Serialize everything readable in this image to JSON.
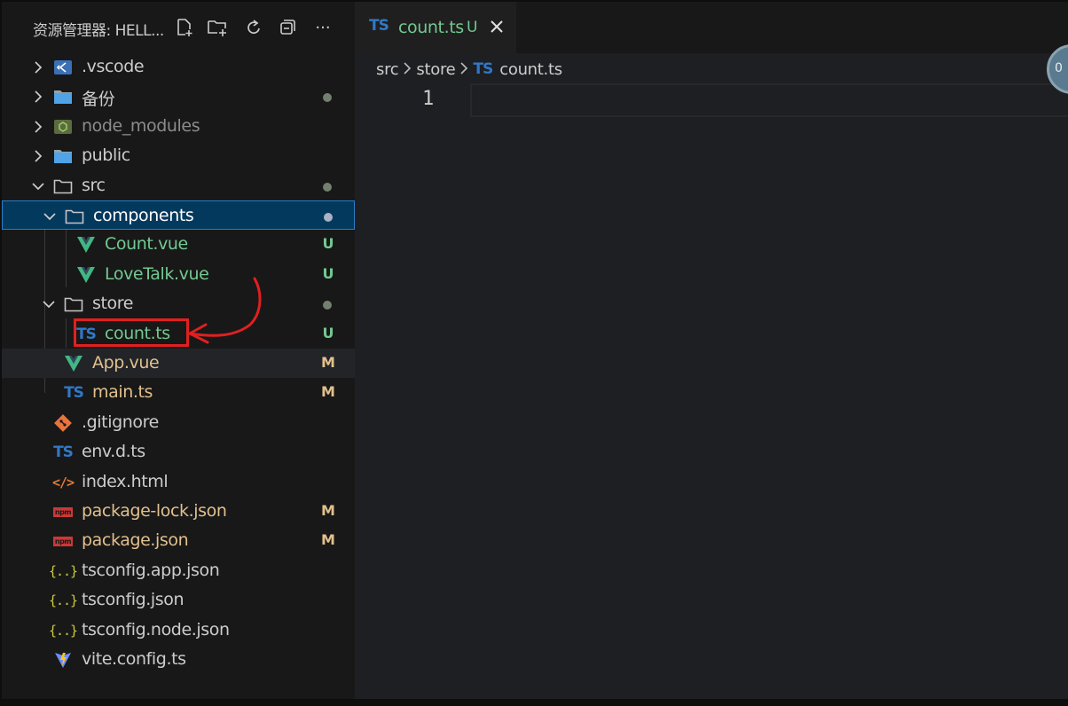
{
  "explorer": {
    "title": "资源管理器: HELL...",
    "actions": [
      "new-file-icon",
      "new-folder-icon",
      "refresh-icon",
      "collapse-all-icon",
      "more-icon"
    ],
    "more_label": "···"
  },
  "tree": [
    {
      "name": ".vscode",
      "type": "folder-vscode",
      "expanded": false,
      "depth": 0,
      "color": "#cccccc"
    },
    {
      "name": "备份",
      "type": "folder",
      "expanded": false,
      "depth": 0,
      "color": "#cccccc",
      "status": "dot"
    },
    {
      "name": "node_modules",
      "type": "folder-node",
      "expanded": false,
      "depth": 0,
      "color": "#8c8c8c"
    },
    {
      "name": "public",
      "type": "folder",
      "expanded": false,
      "depth": 0,
      "color": "#cccccc"
    },
    {
      "name": "src",
      "type": "folder-open",
      "expanded": true,
      "depth": 0,
      "color": "#cccccc",
      "status": "dot"
    },
    {
      "name": "components",
      "type": "folder-open",
      "expanded": true,
      "depth": 1,
      "color": "#ffffff",
      "status": "dot",
      "selected": true
    },
    {
      "name": "Count.vue",
      "type": "vue",
      "depth": 2,
      "color": "#73c991",
      "status": "U"
    },
    {
      "name": "LoveTalk.vue",
      "type": "vue",
      "depth": 2,
      "color": "#73c991",
      "status": "U"
    },
    {
      "name": "store",
      "type": "folder-open",
      "expanded": true,
      "depth": 1,
      "color": "#cccccc",
      "status": "dot"
    },
    {
      "name": "count.ts",
      "type": "ts",
      "depth": 2,
      "color": "#73c991",
      "status": "U"
    },
    {
      "name": "App.vue",
      "type": "vue",
      "depth": 1,
      "color": "#e2c08d",
      "status": "M",
      "hovered": true
    },
    {
      "name": "main.ts",
      "type": "ts",
      "depth": 1,
      "color": "#e2c08d",
      "status": "M"
    },
    {
      "name": ".gitignore",
      "type": "git",
      "depth": 0,
      "color": "#cccccc"
    },
    {
      "name": "env.d.ts",
      "type": "ts",
      "depth": 0,
      "color": "#cccccc"
    },
    {
      "name": "index.html",
      "type": "html",
      "depth": 0,
      "color": "#cccccc"
    },
    {
      "name": "package-lock.json",
      "type": "npm",
      "depth": 0,
      "color": "#e2c08d",
      "status": "M"
    },
    {
      "name": "package.json",
      "type": "npm",
      "depth": 0,
      "color": "#e2c08d",
      "status": "M"
    },
    {
      "name": "tsconfig.app.json",
      "type": "json",
      "depth": 0,
      "color": "#cccccc"
    },
    {
      "name": "tsconfig.json",
      "type": "json",
      "depth": 0,
      "color": "#cccccc"
    },
    {
      "name": "tsconfig.node.json",
      "type": "json",
      "depth": 0,
      "color": "#cccccc"
    },
    {
      "name": "vite.config.ts",
      "type": "vite",
      "depth": 0,
      "color": "#cccccc"
    }
  ],
  "labels": {
    "ts": "TS",
    "npm": "npm",
    "json": "{..}",
    "html": "</>"
  },
  "tab": {
    "icon_label": "TS",
    "label": "count.ts",
    "status": "U"
  },
  "breadcrumb": {
    "parts": [
      "src",
      "store"
    ],
    "file_icon": "TS",
    "file": "count.ts"
  },
  "editor": {
    "line_number": "1",
    "minimap_label": "0"
  },
  "colors": {
    "untracked": "#73c991",
    "modified": "#e2c08d",
    "selection": "#04395e",
    "annotation": "#e02020"
  }
}
